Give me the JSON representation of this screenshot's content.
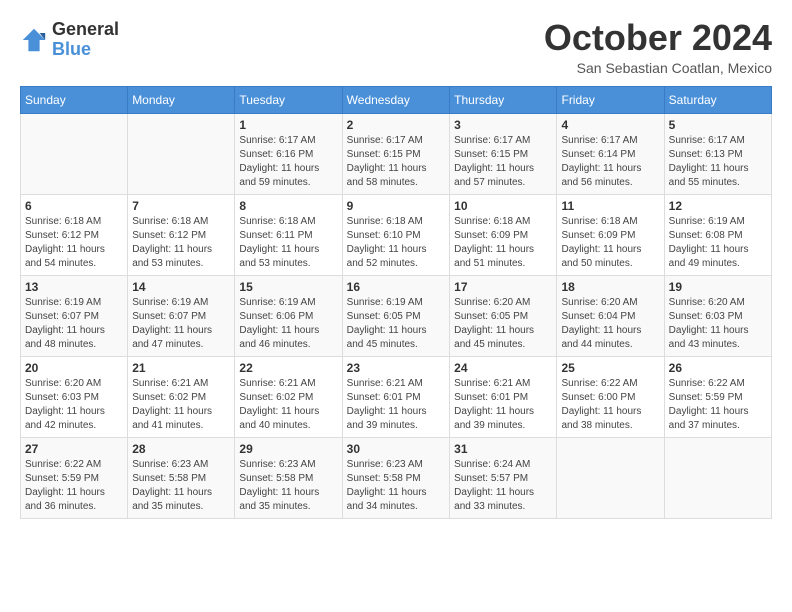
{
  "header": {
    "logo": {
      "general": "General",
      "blue": "Blue"
    },
    "title": "October 2024",
    "location": "San Sebastian Coatlan, Mexico"
  },
  "days_of_week": [
    "Sunday",
    "Monday",
    "Tuesday",
    "Wednesday",
    "Thursday",
    "Friday",
    "Saturday"
  ],
  "weeks": [
    [
      {
        "day": null,
        "info": ""
      },
      {
        "day": null,
        "info": ""
      },
      {
        "day": "1",
        "sunrise": "Sunrise: 6:17 AM",
        "sunset": "Sunset: 6:16 PM",
        "daylight": "Daylight: 11 hours and 59 minutes."
      },
      {
        "day": "2",
        "sunrise": "Sunrise: 6:17 AM",
        "sunset": "Sunset: 6:15 PM",
        "daylight": "Daylight: 11 hours and 58 minutes."
      },
      {
        "day": "3",
        "sunrise": "Sunrise: 6:17 AM",
        "sunset": "Sunset: 6:15 PM",
        "daylight": "Daylight: 11 hours and 57 minutes."
      },
      {
        "day": "4",
        "sunrise": "Sunrise: 6:17 AM",
        "sunset": "Sunset: 6:14 PM",
        "daylight": "Daylight: 11 hours and 56 minutes."
      },
      {
        "day": "5",
        "sunrise": "Sunrise: 6:17 AM",
        "sunset": "Sunset: 6:13 PM",
        "daylight": "Daylight: 11 hours and 55 minutes."
      }
    ],
    [
      {
        "day": "6",
        "sunrise": "Sunrise: 6:18 AM",
        "sunset": "Sunset: 6:12 PM",
        "daylight": "Daylight: 11 hours and 54 minutes."
      },
      {
        "day": "7",
        "sunrise": "Sunrise: 6:18 AM",
        "sunset": "Sunset: 6:12 PM",
        "daylight": "Daylight: 11 hours and 53 minutes."
      },
      {
        "day": "8",
        "sunrise": "Sunrise: 6:18 AM",
        "sunset": "Sunset: 6:11 PM",
        "daylight": "Daylight: 11 hours and 53 minutes."
      },
      {
        "day": "9",
        "sunrise": "Sunrise: 6:18 AM",
        "sunset": "Sunset: 6:10 PM",
        "daylight": "Daylight: 11 hours and 52 minutes."
      },
      {
        "day": "10",
        "sunrise": "Sunrise: 6:18 AM",
        "sunset": "Sunset: 6:09 PM",
        "daylight": "Daylight: 11 hours and 51 minutes."
      },
      {
        "day": "11",
        "sunrise": "Sunrise: 6:18 AM",
        "sunset": "Sunset: 6:09 PM",
        "daylight": "Daylight: 11 hours and 50 minutes."
      },
      {
        "day": "12",
        "sunrise": "Sunrise: 6:19 AM",
        "sunset": "Sunset: 6:08 PM",
        "daylight": "Daylight: 11 hours and 49 minutes."
      }
    ],
    [
      {
        "day": "13",
        "sunrise": "Sunrise: 6:19 AM",
        "sunset": "Sunset: 6:07 PM",
        "daylight": "Daylight: 11 hours and 48 minutes."
      },
      {
        "day": "14",
        "sunrise": "Sunrise: 6:19 AM",
        "sunset": "Sunset: 6:07 PM",
        "daylight": "Daylight: 11 hours and 47 minutes."
      },
      {
        "day": "15",
        "sunrise": "Sunrise: 6:19 AM",
        "sunset": "Sunset: 6:06 PM",
        "daylight": "Daylight: 11 hours and 46 minutes."
      },
      {
        "day": "16",
        "sunrise": "Sunrise: 6:19 AM",
        "sunset": "Sunset: 6:05 PM",
        "daylight": "Daylight: 11 hours and 45 minutes."
      },
      {
        "day": "17",
        "sunrise": "Sunrise: 6:20 AM",
        "sunset": "Sunset: 6:05 PM",
        "daylight": "Daylight: 11 hours and 45 minutes."
      },
      {
        "day": "18",
        "sunrise": "Sunrise: 6:20 AM",
        "sunset": "Sunset: 6:04 PM",
        "daylight": "Daylight: 11 hours and 44 minutes."
      },
      {
        "day": "19",
        "sunrise": "Sunrise: 6:20 AM",
        "sunset": "Sunset: 6:03 PM",
        "daylight": "Daylight: 11 hours and 43 minutes."
      }
    ],
    [
      {
        "day": "20",
        "sunrise": "Sunrise: 6:20 AM",
        "sunset": "Sunset: 6:03 PM",
        "daylight": "Daylight: 11 hours and 42 minutes."
      },
      {
        "day": "21",
        "sunrise": "Sunrise: 6:21 AM",
        "sunset": "Sunset: 6:02 PM",
        "daylight": "Daylight: 11 hours and 41 minutes."
      },
      {
        "day": "22",
        "sunrise": "Sunrise: 6:21 AM",
        "sunset": "Sunset: 6:02 PM",
        "daylight": "Daylight: 11 hours and 40 minutes."
      },
      {
        "day": "23",
        "sunrise": "Sunrise: 6:21 AM",
        "sunset": "Sunset: 6:01 PM",
        "daylight": "Daylight: 11 hours and 39 minutes."
      },
      {
        "day": "24",
        "sunrise": "Sunrise: 6:21 AM",
        "sunset": "Sunset: 6:01 PM",
        "daylight": "Daylight: 11 hours and 39 minutes."
      },
      {
        "day": "25",
        "sunrise": "Sunrise: 6:22 AM",
        "sunset": "Sunset: 6:00 PM",
        "daylight": "Daylight: 11 hours and 38 minutes."
      },
      {
        "day": "26",
        "sunrise": "Sunrise: 6:22 AM",
        "sunset": "Sunset: 5:59 PM",
        "daylight": "Daylight: 11 hours and 37 minutes."
      }
    ],
    [
      {
        "day": "27",
        "sunrise": "Sunrise: 6:22 AM",
        "sunset": "Sunset: 5:59 PM",
        "daylight": "Daylight: 11 hours and 36 minutes."
      },
      {
        "day": "28",
        "sunrise": "Sunrise: 6:23 AM",
        "sunset": "Sunset: 5:58 PM",
        "daylight": "Daylight: 11 hours and 35 minutes."
      },
      {
        "day": "29",
        "sunrise": "Sunrise: 6:23 AM",
        "sunset": "Sunset: 5:58 PM",
        "daylight": "Daylight: 11 hours and 35 minutes."
      },
      {
        "day": "30",
        "sunrise": "Sunrise: 6:23 AM",
        "sunset": "Sunset: 5:58 PM",
        "daylight": "Daylight: 11 hours and 34 minutes."
      },
      {
        "day": "31",
        "sunrise": "Sunrise: 6:24 AM",
        "sunset": "Sunset: 5:57 PM",
        "daylight": "Daylight: 11 hours and 33 minutes."
      },
      {
        "day": null,
        "info": ""
      },
      {
        "day": null,
        "info": ""
      }
    ]
  ]
}
